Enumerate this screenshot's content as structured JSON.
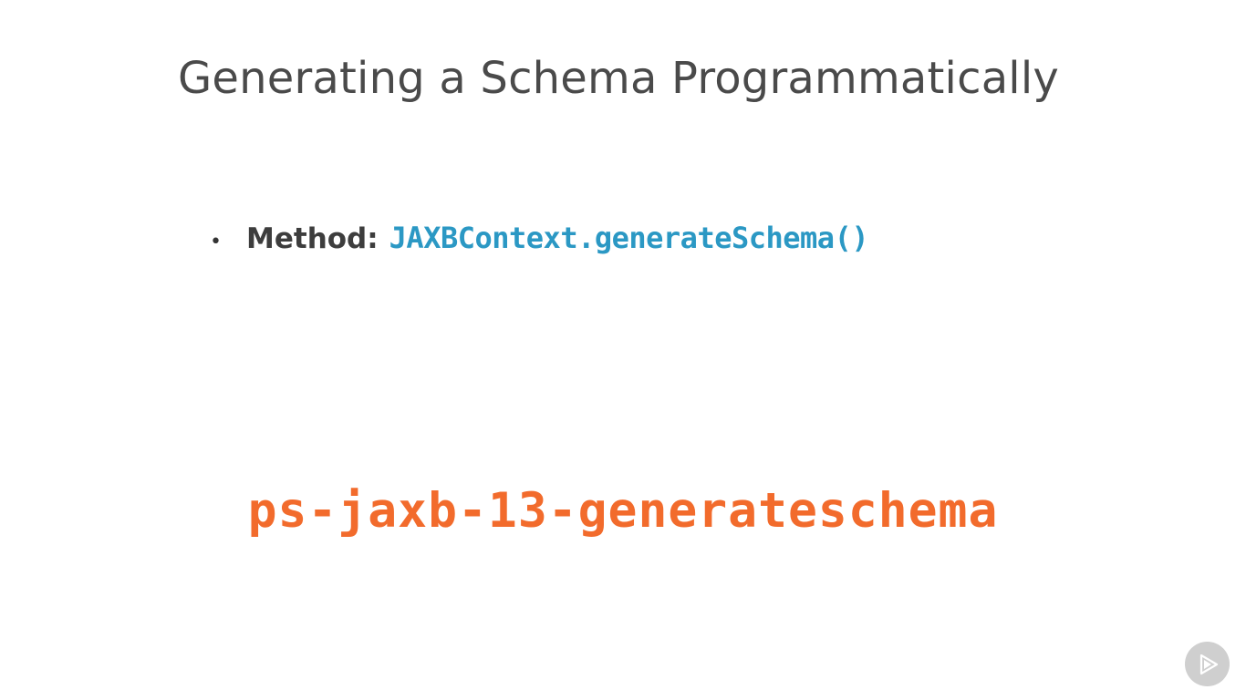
{
  "slide": {
    "title": "Generating a Schema Programmatically",
    "bullets": [
      {
        "label": "Method:",
        "code": "JAXBContext.generateSchema()"
      }
    ],
    "project_name": "ps-jaxb-13-generateschema"
  },
  "colors": {
    "title": "#4a4a4a",
    "code": "#2b98c4",
    "project_name": "#f26b2c",
    "play_button_bg": "#cfcfcf"
  },
  "icons": {
    "play_button": "play-logo-icon"
  }
}
